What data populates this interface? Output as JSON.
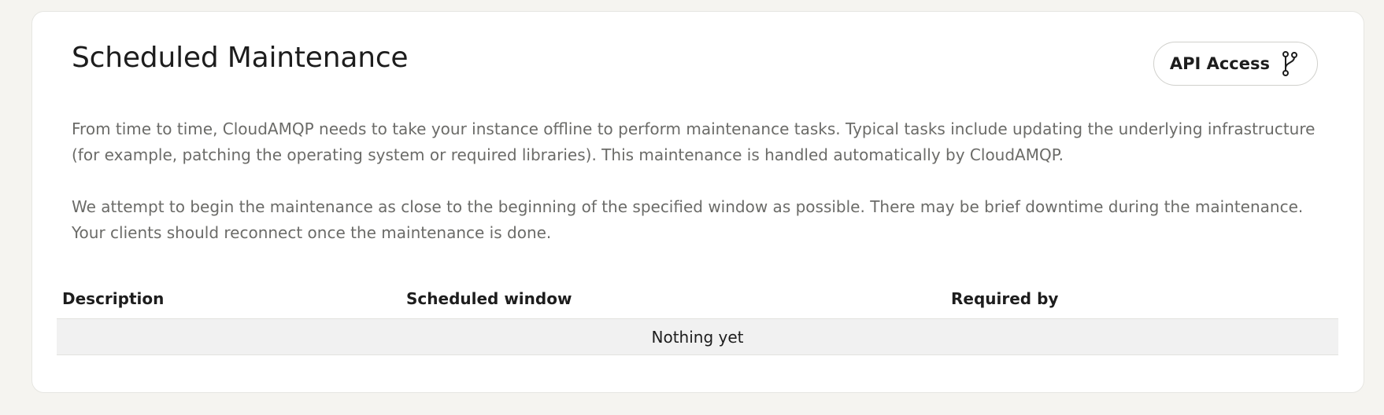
{
  "section": {
    "title": "Scheduled Maintenance",
    "api_button": {
      "label": "API Access",
      "icon": "git-branch-icon"
    },
    "paragraphs": [
      "From time to time, CloudAMQP needs to take your instance offline to perform maintenance tasks. Typical tasks include updating the underlying infrastructure (for example, patching the operating system or required libraries). This maintenance is handled automatically by CloudAMQP.",
      "We attempt to begin the maintenance as close to the beginning of the specified window as possible. There may be brief downtime during the maintenance. Your clients should reconnect once the maintenance is done."
    ]
  },
  "table": {
    "columns": [
      "Description",
      "Scheduled window",
      "Required by"
    ],
    "empty_message": "Nothing yet"
  }
}
